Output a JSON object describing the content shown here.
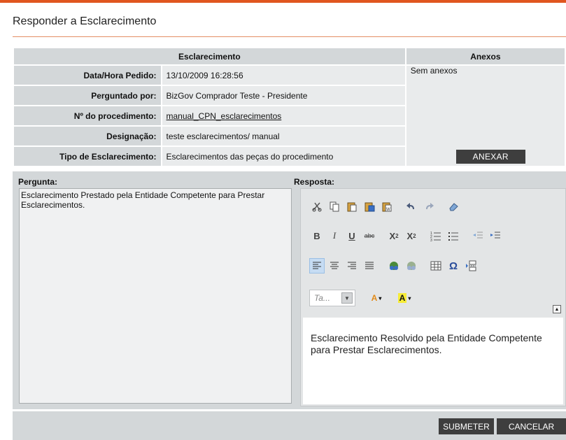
{
  "page": {
    "title": "Responder a Esclarecimento"
  },
  "esclarecimento": {
    "header": "Esclarecimento",
    "rows": [
      {
        "label": "Data/Hora Pedido:",
        "value": "13/10/2009 16:28:56"
      },
      {
        "label": "Perguntado por:",
        "value": "BizGov Comprador Teste - Presidente"
      },
      {
        "label": "Nº do procedimento:",
        "value": "manual_CPN_esclarecimentos"
      },
      {
        "label": "Designação:",
        "value": "teste esclarecimentos/ manual"
      },
      {
        "label": "Tipo de Esclarecimento:",
        "value": "Esclarecimentos das peças do procedimento"
      }
    ]
  },
  "anexos": {
    "header": "Anexos",
    "empty_text": "Sem anexos",
    "anexar_label": "ANEXAR"
  },
  "pergunta": {
    "label": "Pergunta:",
    "text": "Esclarecimento Prestado pela Entidade Competente para Prestar Esclarecimentos."
  },
  "resposta": {
    "label": "Resposta:",
    "font_placeholder": "Ta...",
    "text": "Esclarecimento Resolvido pela Entidade Competente para Prestar Esclarecimentos."
  },
  "toolbar_icons": {
    "row1": [
      "cut-icon",
      "copy-icon",
      "paste-icon",
      "paste-word-icon",
      "paste-text-icon",
      "undo-icon",
      "redo-icon",
      "eraser-icon"
    ],
    "row2": [
      "bold-icon",
      "italic-icon",
      "underline-icon",
      "strikethrough-icon",
      "subscript-icon",
      "superscript-icon",
      "ordered-list-icon",
      "unordered-list-icon",
      "outdent-icon",
      "indent-icon"
    ],
    "row3": [
      "align-left-icon",
      "align-center-icon",
      "align-right-icon",
      "align-justify-icon",
      "link-icon",
      "unlink-icon",
      "table-icon",
      "special-char-icon",
      "page-break-icon"
    ],
    "row4": [
      "font-color-icon",
      "highlight-color-icon"
    ]
  },
  "actions": {
    "submit_label": "SUBMETER",
    "cancel_label": "CANCELAR"
  },
  "colors": {
    "accent": "#e0561f",
    "dark_button": "#3e3e3e",
    "panel": "#d3d7d9"
  }
}
